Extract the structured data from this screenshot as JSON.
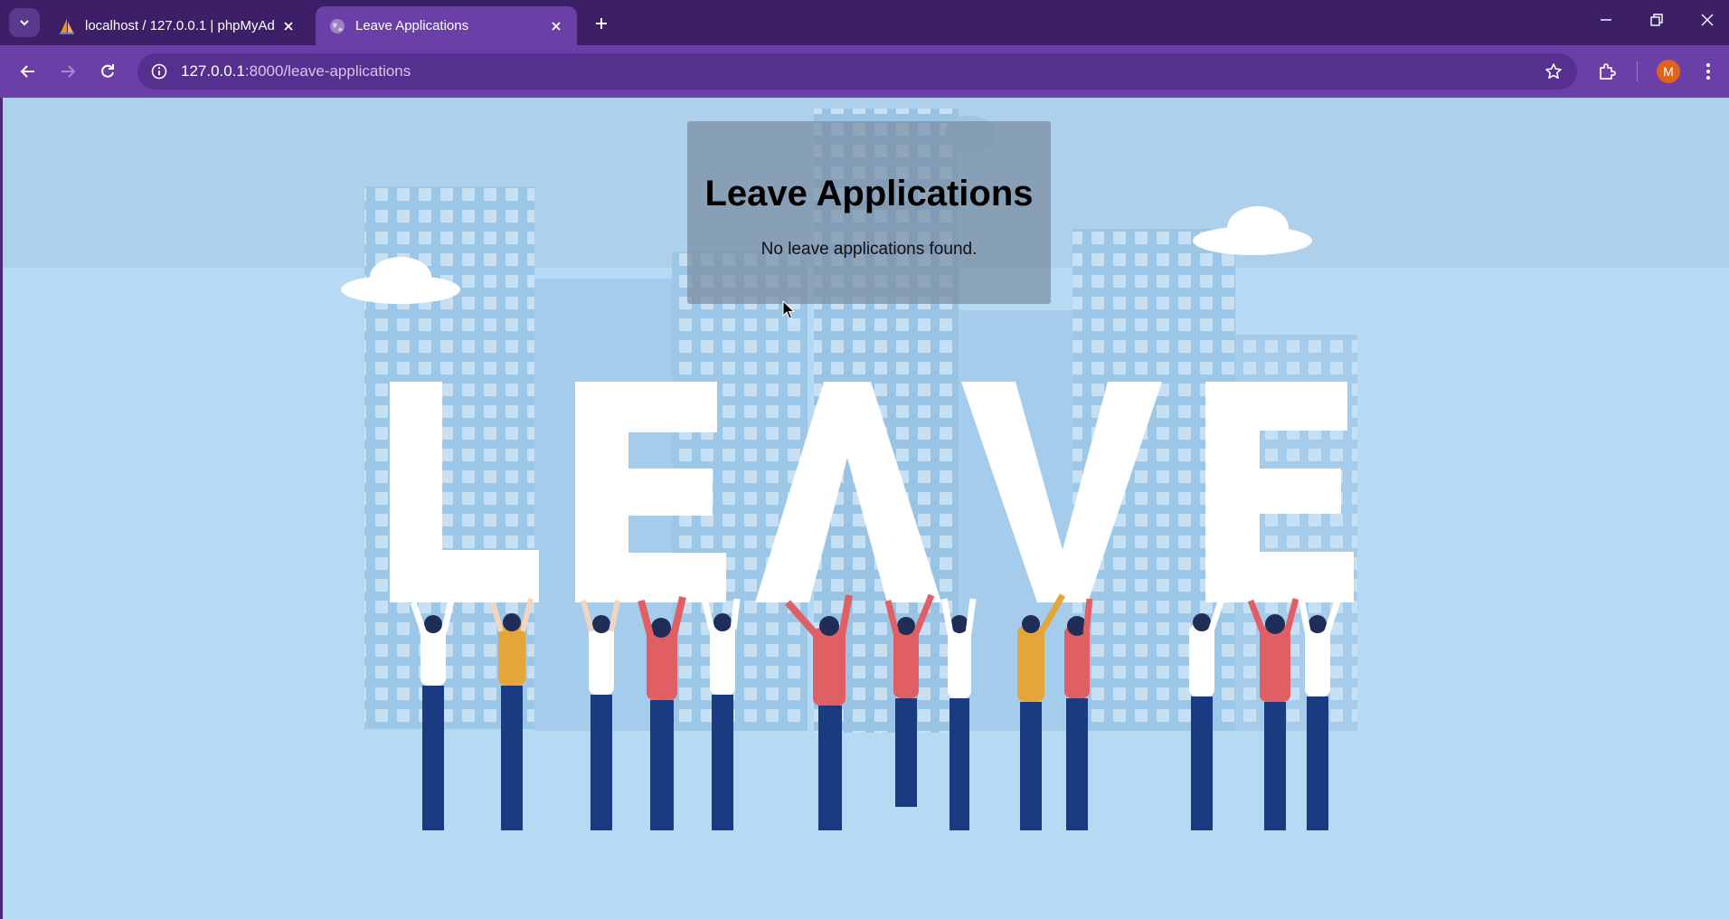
{
  "browser": {
    "tabs": [
      {
        "title": "localhost / 127.0.0.1 | phpMyAd",
        "icon": "phpmyadmin-sail-icon",
        "active": false
      },
      {
        "title": "Leave Applications",
        "icon": "globe-icon",
        "active": true
      }
    ],
    "address": {
      "host": "127.0.0.1",
      "path": ":8000/leave-applications"
    },
    "profile_initial": "M"
  },
  "page": {
    "heading": "Leave Applications",
    "empty_message": "No leave applications found.",
    "hero_image": {
      "word": "LEAVE"
    }
  },
  "colors": {
    "tabstrip": "#3c1f66",
    "toolbar": "#6a3fa8",
    "page_background": "#b3d7f0",
    "card": "#7a8ea2",
    "avatar": "#e2621b"
  }
}
